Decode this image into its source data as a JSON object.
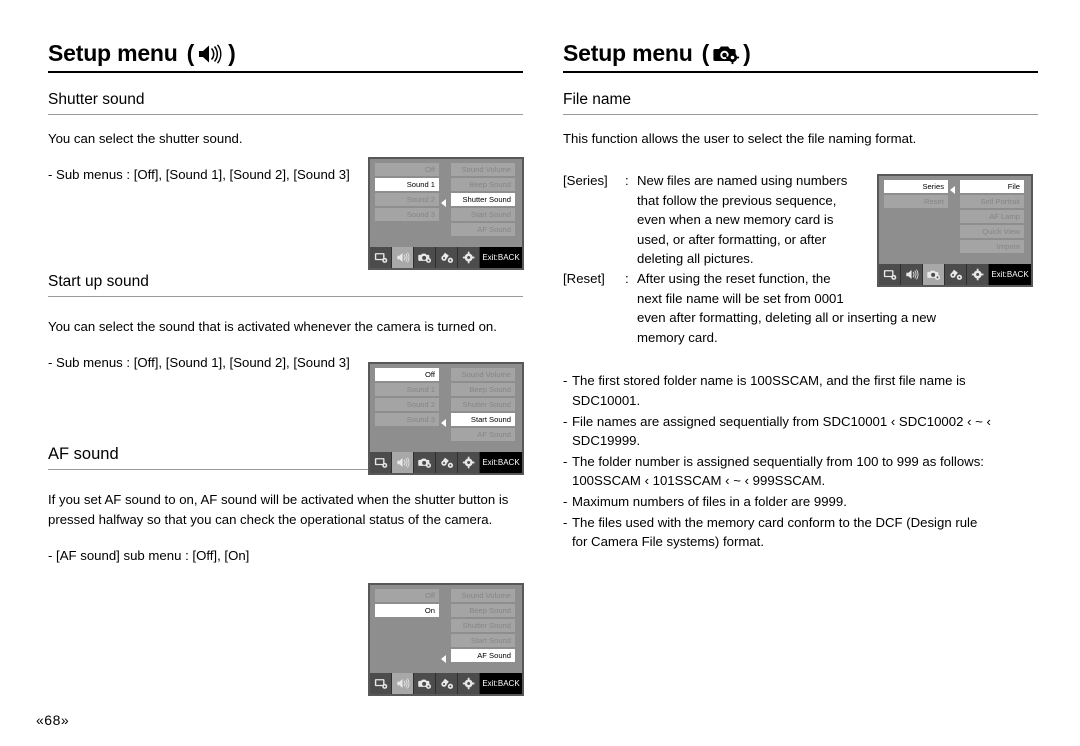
{
  "page": {
    "number": "«68»"
  },
  "left_column": {
    "menu_title": {
      "text": "Setup menu",
      "open_paren": "(",
      "close_paren": ")",
      "icon": "speaker-icon"
    },
    "sections": [
      {
        "title": "Shutter sound",
        "body": "You can select the shutter sound.",
        "submenu_line": "- Sub menus : [Off], [Sound 1], [Sound 2], [Sound 3]"
      },
      {
        "title": "Start up sound",
        "body": "You can select the sound that is activated whenever the camera is turned on.",
        "submenu_line": "- Sub menus : [Off], [Sound 1], [Sound 2], [Sound 3]"
      },
      {
        "title": "AF sound",
        "body": "If you set AF sound to on, AF sound will be activated when the shutter button is pressed halfway so that you can check the operational status of the camera.",
        "submenu_line": "- [AF sound] sub menu : [Off], [On]"
      }
    ]
  },
  "right_column": {
    "menu_title": {
      "text": "Setup menu",
      "open_paren": "(",
      "close_paren": ")",
      "icon": "camera-settings-icon"
    },
    "section": {
      "title": "File name",
      "body": "This function allows the user to select the file naming format."
    },
    "definitions": [
      {
        "term": "[Series]",
        "sep": ":",
        "lines": [
          "New files are named using numbers",
          "that follow the previous sequence,",
          "even when a new memory card is",
          "used, or after formatting, or after",
          "deleting all pictures."
        ]
      },
      {
        "term": "[Reset]",
        "sep": ":",
        "lines": [
          "After using the reset function, the",
          "next file name will be set from 0001",
          "even after formatting, deleting all or inserting a new",
          "memory card."
        ]
      }
    ],
    "bullets": [
      {
        "dash": "-",
        "lines": [
          "The first stored folder name is 100SSCAM, and the first file name is",
          "SDC10001."
        ]
      },
      {
        "dash": "-",
        "lines": [
          "File names are assigned sequentially from SDC10001 ‹ SDC10002 ‹ ~ ‹",
          "SDC19999."
        ]
      },
      {
        "dash": "-",
        "lines": [
          "The folder number is assigned sequentially from 100 to 999 as follows:",
          "100SSCAM ‹ 101SSCAM ‹ ~ ‹ 999SSCAM."
        ]
      },
      {
        "dash": "-",
        "lines": [
          "Maximum numbers of files in a folder are 9999."
        ]
      },
      {
        "dash": "-",
        "lines": [
          "The files used with the memory card conform to the DCF (Design rule",
          "for Camera File systems) format."
        ]
      }
    ]
  },
  "lcd_screens": [
    {
      "id": "shutter-sound-screen",
      "left_items": [
        {
          "label": "Off",
          "state": "dim"
        },
        {
          "label": "Sound 1",
          "state": "selected"
        },
        {
          "label": "Sound 2",
          "state": "dim"
        },
        {
          "label": "Sound 3",
          "state": "dim"
        }
      ],
      "right_items": [
        {
          "label": "Sound Volume",
          "state": "dim"
        },
        {
          "label": "Beep Sound",
          "state": "dim"
        },
        {
          "label": "Shutter Sound",
          "state": "selected"
        },
        {
          "label": "Start Sound",
          "state": "dim"
        },
        {
          "label": "AF Sound",
          "state": "dim"
        }
      ],
      "arrow_row": 2,
      "active_tab": 1,
      "exit_label": "Exit:BACK"
    },
    {
      "id": "start-up-sound-screen",
      "left_items": [
        {
          "label": "Off",
          "state": "selected"
        },
        {
          "label": "Sound 1",
          "state": "dim"
        },
        {
          "label": "Sound 2",
          "state": "dim"
        },
        {
          "label": "Sound 3",
          "state": "dim"
        }
      ],
      "right_items": [
        {
          "label": "Sound Volume",
          "state": "dim"
        },
        {
          "label": "Beep Sound",
          "state": "dim"
        },
        {
          "label": "Shutter Sound",
          "state": "dim"
        },
        {
          "label": "Start Sound",
          "state": "selected"
        },
        {
          "label": "AF Sound",
          "state": "dim"
        }
      ],
      "arrow_row": 3,
      "active_tab": 1,
      "exit_label": "Exit:BACK"
    },
    {
      "id": "af-sound-screen",
      "left_items": [
        {
          "label": "Off",
          "state": "dim"
        },
        {
          "label": "On",
          "state": "selected"
        },
        {
          "label": "",
          "state": "blank"
        },
        {
          "label": "",
          "state": "blank"
        }
      ],
      "right_items": [
        {
          "label": "Sound Volume",
          "state": "dim"
        },
        {
          "label": "Beep Sound",
          "state": "dim"
        },
        {
          "label": "Shutter Sound",
          "state": "dim"
        },
        {
          "label": "Start Sound",
          "state": "dim"
        },
        {
          "label": "AF Sound",
          "state": "selected"
        }
      ],
      "arrow_row": 4,
      "active_tab": 1,
      "exit_label": "Exit:BACK"
    },
    {
      "id": "file-name-screen",
      "left_items": [
        {
          "label": "Series",
          "state": "selected"
        },
        {
          "label": "Reset",
          "state": "dim"
        },
        {
          "label": "",
          "state": "blank"
        },
        {
          "label": "",
          "state": "blank"
        }
      ],
      "right_items": [
        {
          "label": "File",
          "state": "selected"
        },
        {
          "label": "Self Portrait",
          "state": "dim"
        },
        {
          "label": "AF Lamp",
          "state": "dim"
        },
        {
          "label": "Quick View",
          "state": "dim"
        },
        {
          "label": "Imprint",
          "state": "dim"
        }
      ],
      "arrow_row": 0,
      "active_tab": 2,
      "exit_label": "Exit:BACK"
    }
  ],
  "tab_icons": [
    "display-settings-icon",
    "sound-settings-icon",
    "camera-settings-icon",
    "shooting-settings-icon",
    "general-settings-icon"
  ]
}
